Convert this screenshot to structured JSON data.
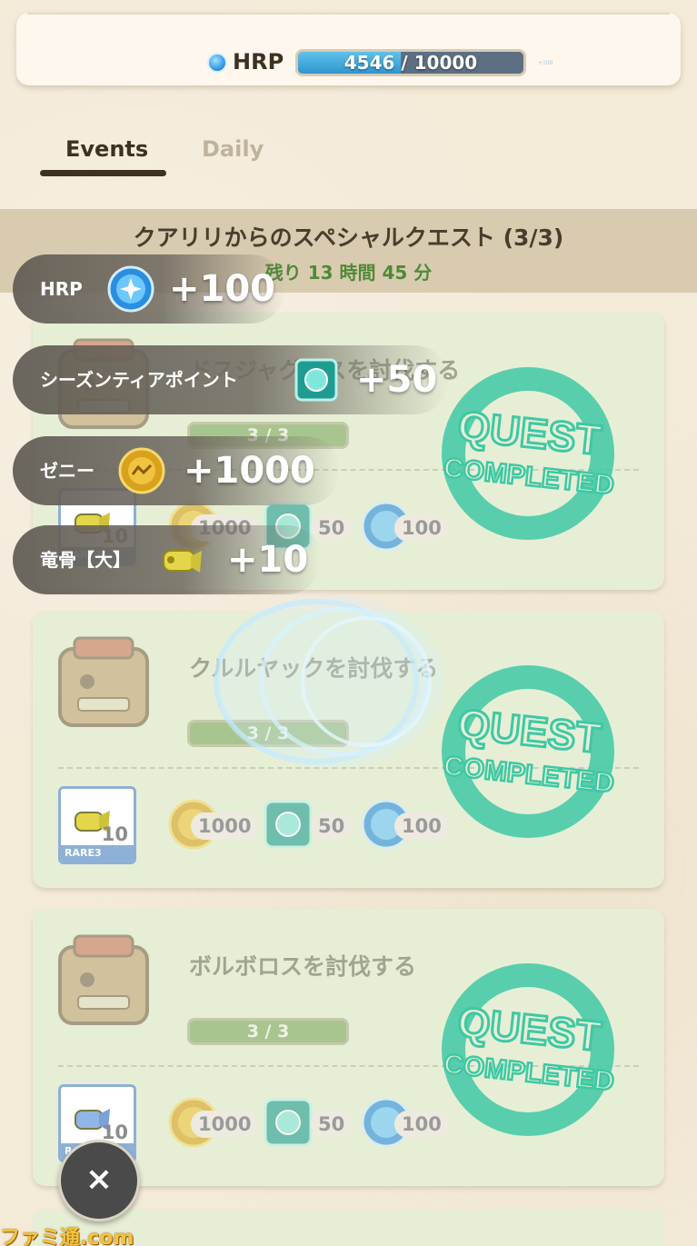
{
  "header": {
    "hrp_label": "HRP",
    "hrp_progress_text": "4546 / 10000",
    "hrp_progress_fraction": 0.4546,
    "tiny_text": "+100"
  },
  "tabs": [
    {
      "label": "Events",
      "active": true
    },
    {
      "label": "Daily",
      "active": false
    }
  ],
  "section": {
    "title": "クアリリからのスペシャルクエスト (3/3)",
    "time_remaining": "残り 13 時間 45 分"
  },
  "quests": [
    {
      "name": "ドスジャグラスを討伐する",
      "progress": "3 / 3",
      "item_count": "10",
      "rarity": "RARE3",
      "zenny": "1000",
      "season_points": "50",
      "hrp": "100",
      "stamp_top": "QUEST",
      "stamp_bottom": "COMPLETED"
    },
    {
      "name": "クルルヤックを討伐する",
      "progress": "3 / 3",
      "item_count": "10",
      "rarity": "RARE3",
      "zenny": "1000",
      "season_points": "50",
      "hrp": "100",
      "stamp_top": "QUEST",
      "stamp_bottom": "COMPLETED"
    },
    {
      "name": "ボルボロスを討伐する",
      "progress": "3 / 3",
      "item_count": "10",
      "rarity": "RARE3",
      "zenny": "1000",
      "season_points": "50",
      "hrp": "100",
      "stamp_top": "QUEST",
      "stamp_bottom": "COMPLETED"
    }
  ],
  "popups": [
    {
      "label": "HRP",
      "value": "+100",
      "icon": "hrp-orb-icon"
    },
    {
      "label": "シーズンティアポイント",
      "value": "+50",
      "icon": "season-point-gem-icon"
    },
    {
      "label": "ゼニー",
      "value": "+1000",
      "icon": "zenny-coin-icon"
    },
    {
      "label": "竜骨【大】",
      "value": "+10",
      "icon": "dragon-bone-icon"
    }
  ],
  "close_label": "×",
  "watermark": "ファミ通.com",
  "colors": {
    "accent_green": "#4f8a37",
    "stamp_teal": "#3ec8a4",
    "card_bg": "#e6efd6",
    "hrp_blue": "#2f95cf"
  }
}
